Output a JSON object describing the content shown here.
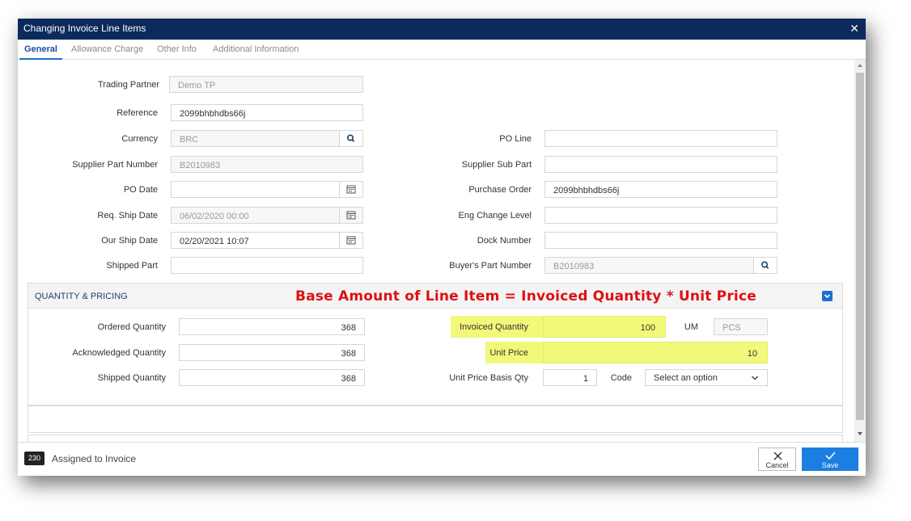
{
  "dialog": {
    "title": "Changing Invoice Line Items",
    "close_glyph": "✕"
  },
  "tabs": [
    "General",
    "Allowance Charge",
    "Other Info",
    "Additional Information"
  ],
  "general": {
    "trading_partner": {
      "label": "Trading Partner",
      "value": "Demo TP"
    },
    "reference": {
      "label": "Reference",
      "value": "2099bhbhdbs66j"
    },
    "currency": {
      "label": "Currency",
      "value": "BRC"
    },
    "supplier_part_number": {
      "label": "Supplier Part Number",
      "value": "B2010983"
    },
    "po_date": {
      "label": "PO Date",
      "value": ""
    },
    "req_ship_date": {
      "label": "Req. Ship Date",
      "value": "06/02/2020 00:00"
    },
    "our_ship_date": {
      "label": "Our Ship Date",
      "value": "02/20/2021 10:07"
    },
    "shipped_part": {
      "label": "Shipped Part",
      "value": ""
    },
    "po_line": {
      "label": "PO Line",
      "value": ""
    },
    "supplier_sub_part": {
      "label": "Supplier Sub Part",
      "value": ""
    },
    "purchase_order": {
      "label": "Purchase Order",
      "value": "2099bhbhdbs66j"
    },
    "eng_change_level": {
      "label": "Eng Change Level",
      "value": ""
    },
    "dock_number": {
      "label": "Dock Number",
      "value": ""
    },
    "buyers_part_number": {
      "label": "Buyer's Part Number",
      "value": "B2010983"
    }
  },
  "qp": {
    "title": "QUANTITY & PRICING",
    "annotation": "Base Amount of Line Item = Invoiced Quantity * Unit Price",
    "ordered_quantity": {
      "label": "Ordered Quantity",
      "value": "368"
    },
    "acknowledged_quantity": {
      "label": "Acknowledged Quantity",
      "value": "368"
    },
    "shipped_quantity": {
      "label": "Shipped Quantity",
      "value": "368"
    },
    "invoiced_quantity": {
      "label": "Invoiced Quantity",
      "value": "100"
    },
    "um": {
      "label": "UM",
      "value": "PCS"
    },
    "unit_price": {
      "label": "Unit Price",
      "value": "10"
    },
    "unit_price_basis_qty": {
      "label": "Unit Price Basis Qty",
      "value": "1"
    },
    "code": {
      "label": "Code",
      "placeholder": "Select an option"
    }
  },
  "footer": {
    "badge": "230",
    "status": "Assigned to Invoice",
    "cancel_label": "Cancel",
    "save_label": "Save"
  },
  "colors": {
    "titlebar": "#0d2a5c",
    "highlight": "#f2f87a",
    "annotation": "#e01010",
    "save": "#1a7fe0"
  }
}
